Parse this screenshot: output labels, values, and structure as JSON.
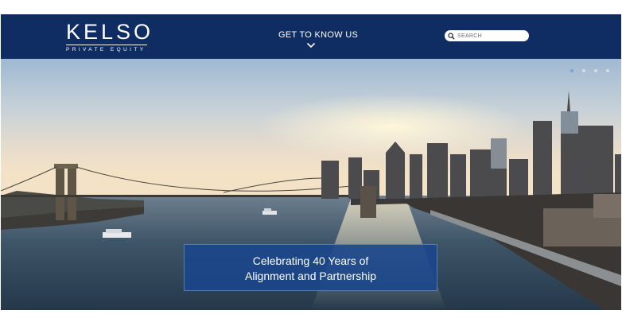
{
  "header": {
    "logo_main": "KELSO",
    "logo_sub": "PRIVATE EQUITY",
    "nav_label": "GET TO KNOW US",
    "search": {
      "placeholder": "SEARCH",
      "value": ""
    }
  },
  "hero": {
    "slide_count": 4,
    "active_slide": 1,
    "banner_line1": "Celebrating 40 Years of",
    "banner_line2": "Alignment and Partnership"
  },
  "colors": {
    "header_bg": "#0f2d63",
    "banner_bg": "#19468c",
    "active_dot": "#7aa2cf"
  }
}
